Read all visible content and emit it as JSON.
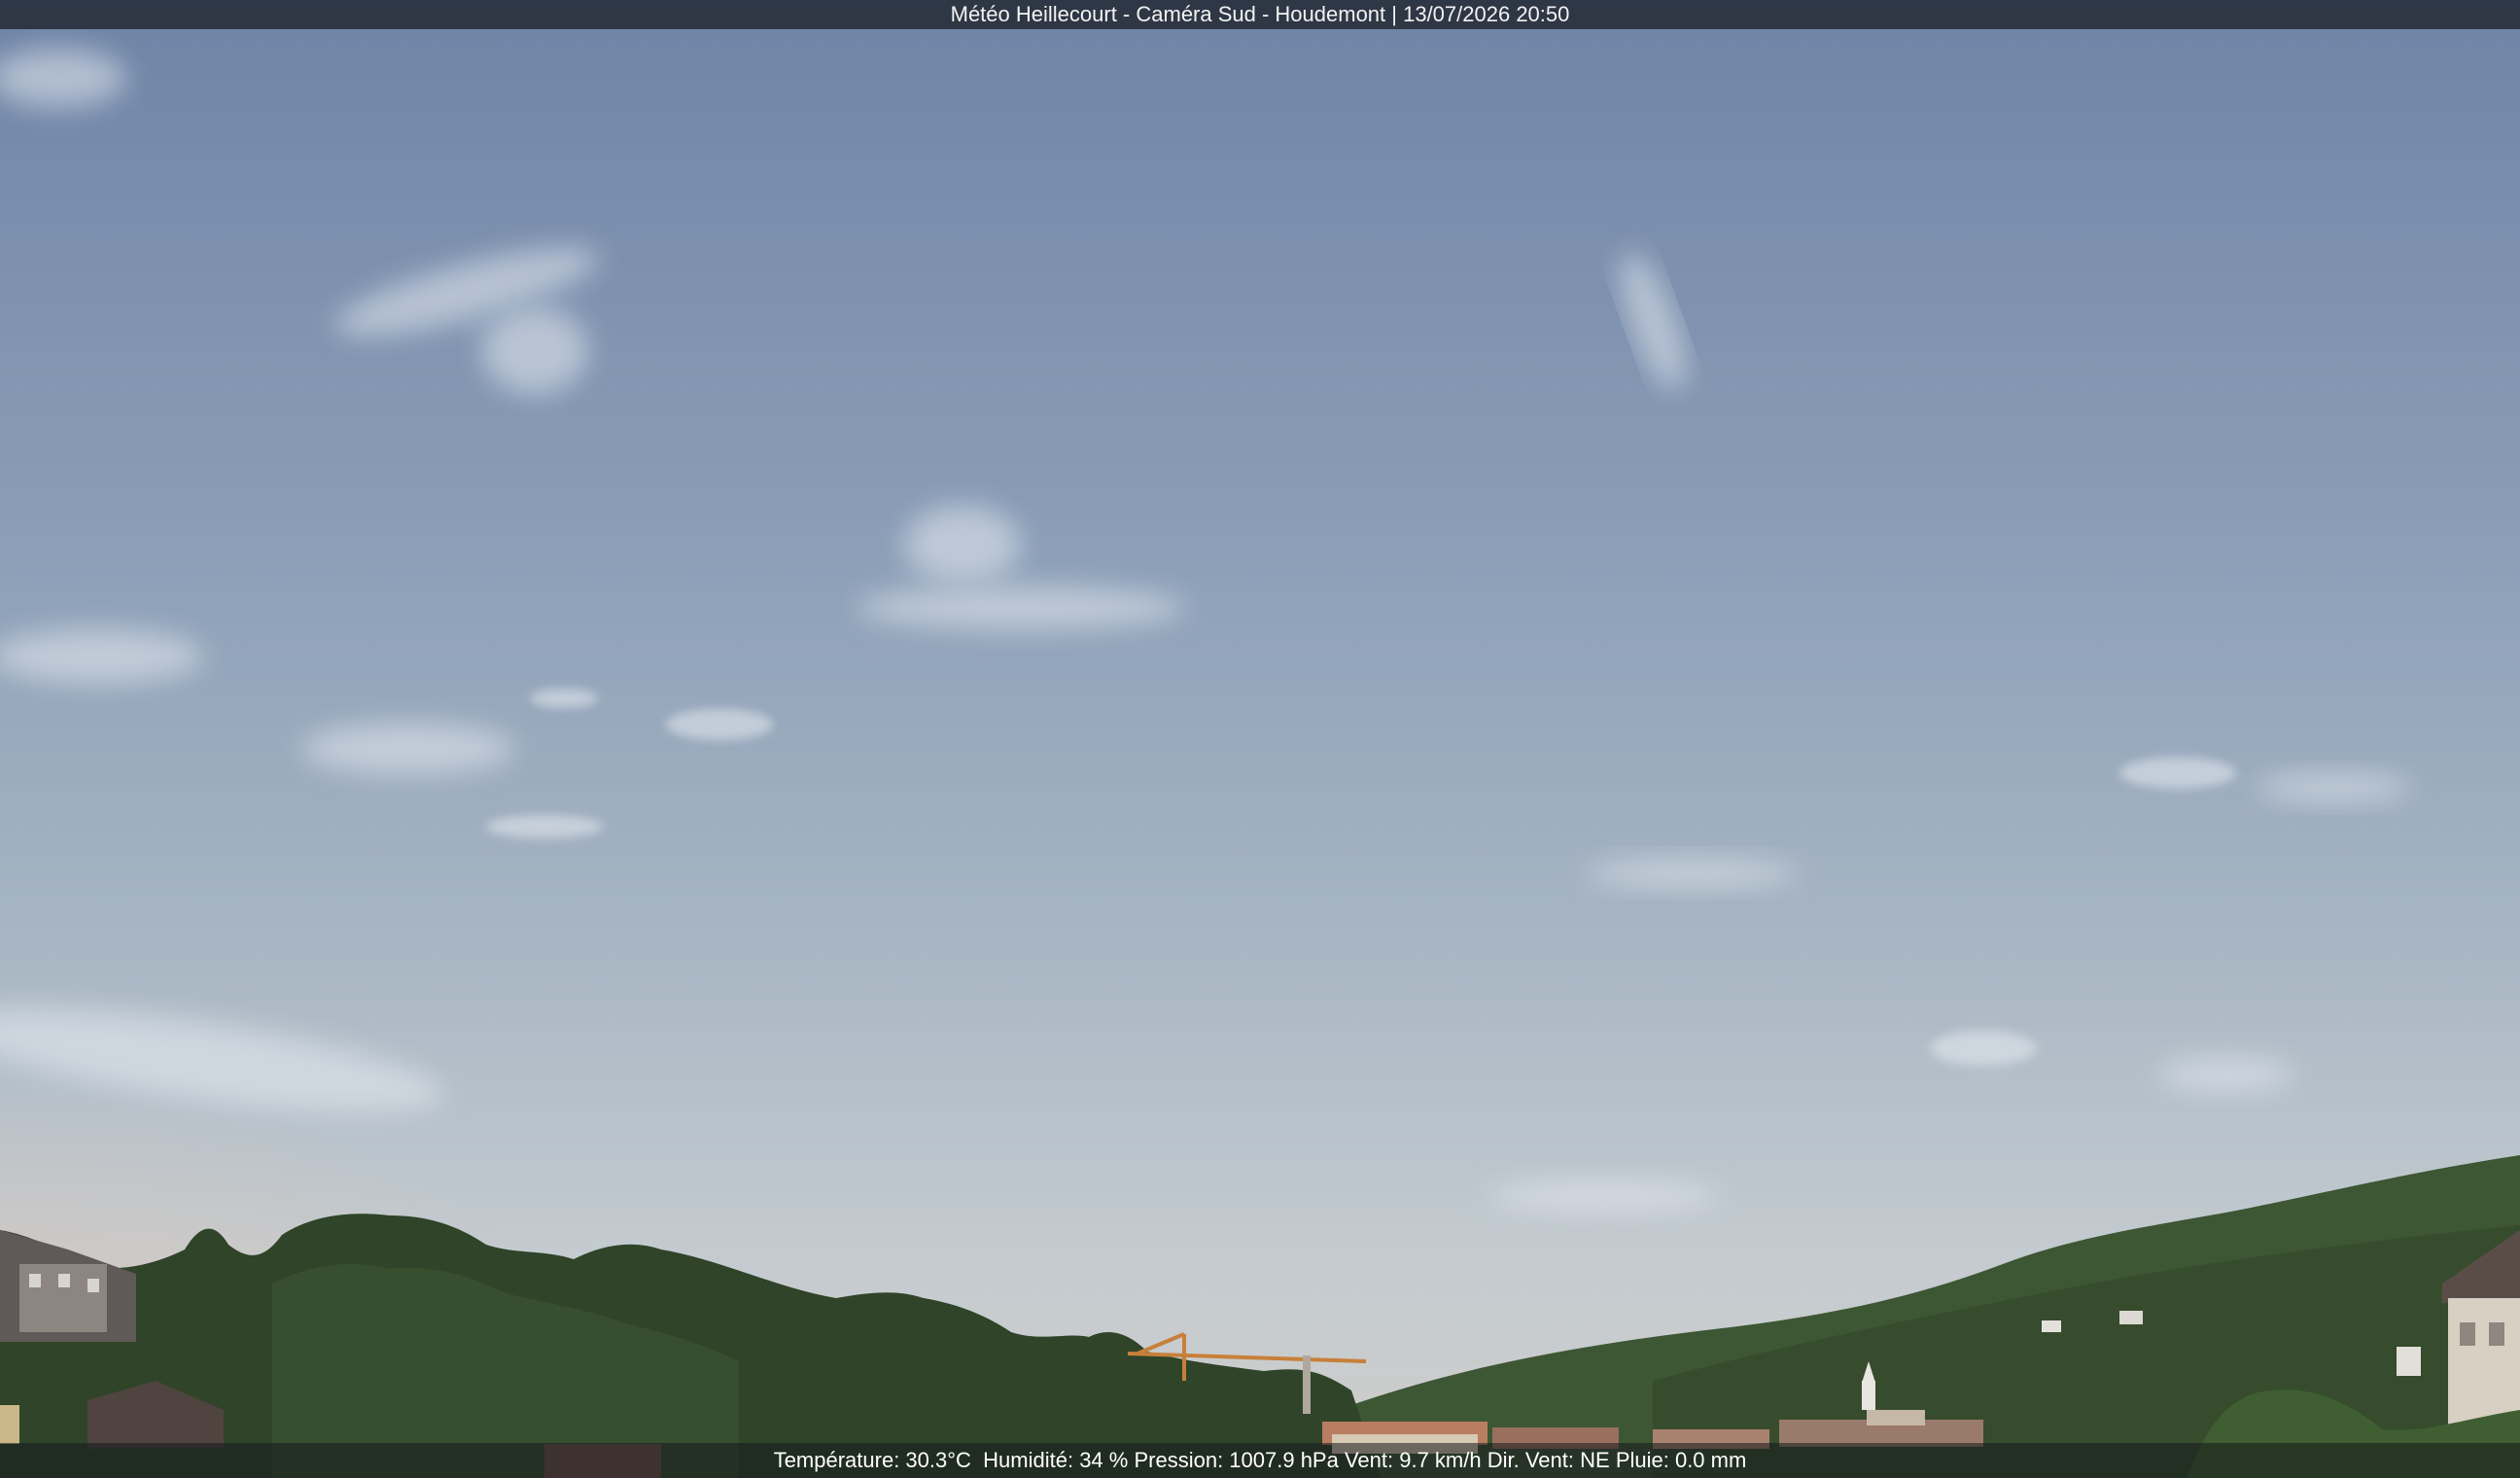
{
  "webcam": {
    "title": "Météo Heillecourt - Caméra Sud - Houdemont | 13/07/2026 20:50",
    "weather": {
      "temperature": "Température: 30.3°C",
      "humidity": "Humidité: 34 %",
      "pressure": "Pression: 1007.9 hPa",
      "wind": "Vent: 9.7 km/h",
      "wind_direction": "Dir. Vent: NE",
      "rain": "Pluie: 0.0 mm"
    }
  },
  "colors": {
    "sky_top": "#7187a9",
    "sky_horizon": "#c4cdd2",
    "sunset_glow": "#d8c4b4",
    "trees": "#2f4428",
    "hills": "#3f5a36",
    "banner": "#262c38"
  }
}
